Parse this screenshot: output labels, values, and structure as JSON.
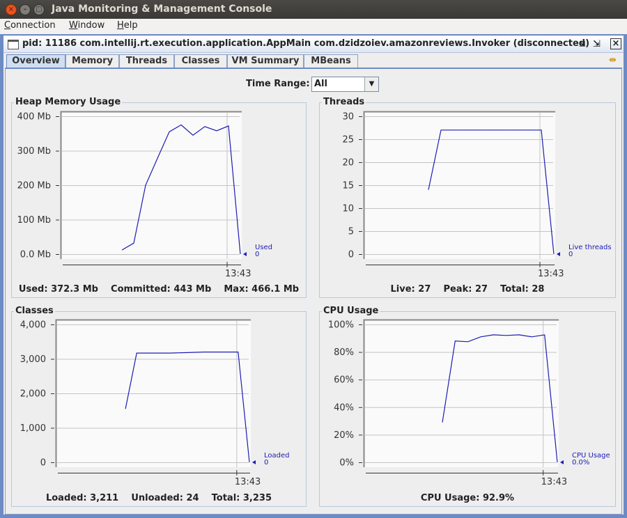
{
  "window": {
    "title": "Java Monitoring & Management Console"
  },
  "menu": [
    {
      "label": "Connection",
      "mnemonic": "C"
    },
    {
      "label": "Window",
      "mnemonic": "W"
    },
    {
      "label": "Help",
      "mnemonic": "H"
    }
  ],
  "internal_frame": {
    "title": "pid: 11186 com.intellij.rt.execution.application.AppMain com.dzidzoiev.amazonreviews.Invoker (disconnected)"
  },
  "tabs": [
    {
      "label": "Overview",
      "active": true
    },
    {
      "label": "Memory"
    },
    {
      "label": "Threads"
    },
    {
      "label": "Classes"
    },
    {
      "label": "VM Summary"
    },
    {
      "label": "MBeans"
    }
  ],
  "time_range": {
    "label": "Time Range:",
    "value": "All"
  },
  "colors": {
    "line": "#1c1cb4",
    "frame_blue": "#6d8bc4"
  },
  "panels": {
    "heap": {
      "title": "Heap Memory Usage",
      "footer": "Used: 372.3 Mb    Committed: 443 Mb    Max: 466.1 Mb"
    },
    "threads": {
      "title": "Threads",
      "footer": "Live: 27    Peak: 27    Total: 28"
    },
    "classes": {
      "title": "Classes",
      "footer": "Loaded: 3,211    Unloaded: 24    Total: 3,235"
    },
    "cpu": {
      "title": "CPU Usage",
      "footer": "CPU Usage: 92.9%"
    }
  },
  "chart_data": [
    {
      "id": "heap",
      "type": "line",
      "ylim": [
        0,
        400
      ],
      "yticks": [
        0,
        100,
        200,
        300,
        400
      ],
      "ytick_labels": [
        "0.0 Mb",
        "100 Mb",
        "200 Mb",
        "300 Mb",
        "400 Mb"
      ],
      "xtick_label": "13:43",
      "xtick_index": 14,
      "grid": true,
      "series": [
        {
          "name": "Used",
          "current": "0",
          "values": [
            null,
            null,
            null,
            null,
            null,
            12,
            32,
            200,
            278,
            355,
            375,
            345,
            370,
            358,
            372,
            0
          ]
        }
      ]
    },
    {
      "id": "threads",
      "type": "line",
      "ylim": [
        0,
        30
      ],
      "yticks": [
        0,
        5,
        10,
        15,
        20,
        25,
        30
      ],
      "ytick_labels": [
        "0",
        "5",
        "10",
        "15",
        "20",
        "25",
        "30"
      ],
      "xtick_label": "13:43",
      "xtick_index": 14,
      "grid": true,
      "series": [
        {
          "name": "Live threads",
          "current": "0",
          "values": [
            null,
            null,
            null,
            null,
            null,
            14,
            27,
            27,
            27,
            27,
            27,
            27,
            27,
            27,
            27,
            0
          ]
        }
      ]
    },
    {
      "id": "classes",
      "type": "line",
      "ylim": [
        0,
        4000
      ],
      "yticks": [
        0,
        1000,
        2000,
        3000,
        4000
      ],
      "ytick_labels": [
        "0",
        "1,000",
        "2,000",
        "3,000",
        "4,000"
      ],
      "xtick_label": "13:43",
      "xtick_index": 16,
      "grid": true,
      "series": [
        {
          "name": "Loaded",
          "current": "0",
          "values": [
            null,
            null,
            null,
            null,
            null,
            null,
            1550,
            3170,
            3170,
            3170,
            3170,
            3180,
            3190,
            3200,
            3200,
            3200,
            3200,
            0
          ]
        }
      ]
    },
    {
      "id": "cpu",
      "type": "line",
      "ylim": [
        0,
        100
      ],
      "yticks": [
        0,
        20,
        40,
        60,
        80,
        100
      ],
      "ytick_labels": [
        "0%",
        "20%",
        "40%",
        "60%",
        "80%",
        "100%"
      ],
      "xtick_label": "13:43",
      "xtick_index": 14,
      "grid": true,
      "series": [
        {
          "name": "CPU Usage",
          "current": "0.0%",
          "values": [
            null,
            null,
            null,
            null,
            null,
            null,
            29,
            88,
            87.5,
            91,
            92.5,
            92,
            92.5,
            91,
            92.5,
            0
          ]
        }
      ]
    }
  ]
}
